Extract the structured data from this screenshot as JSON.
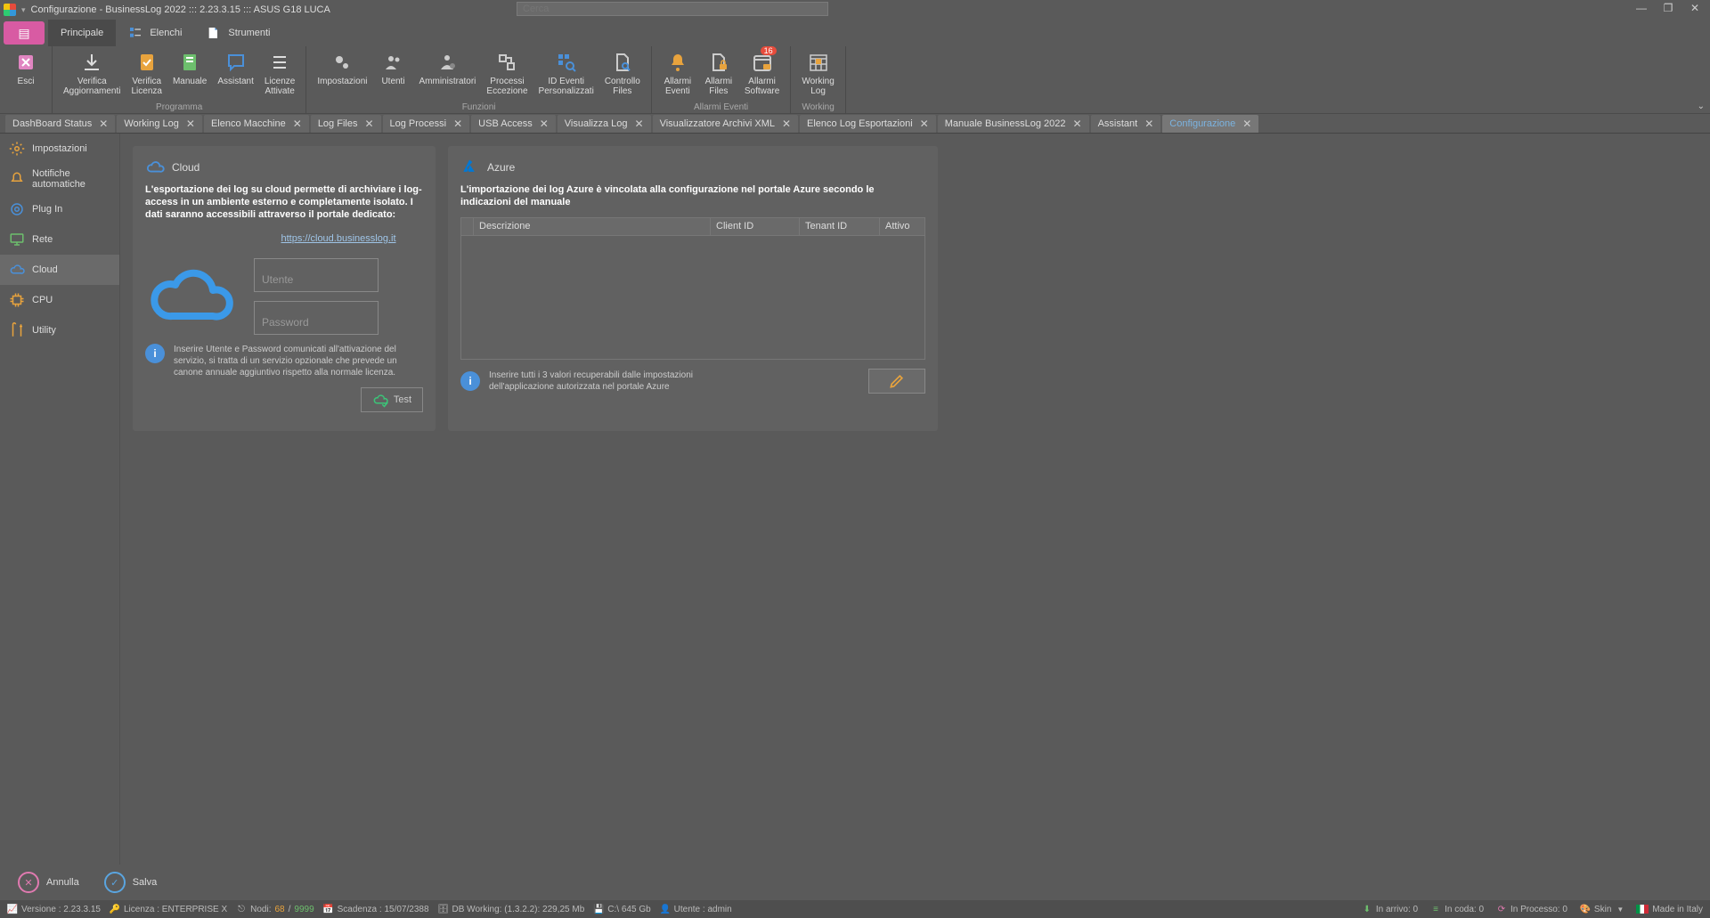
{
  "title": "Configurazione - BusinessLog 2022 ::: 2.23.3.15 ::: ASUS G18 LUCA",
  "search_placeholder": "Cerca",
  "ribbon_tabs": {
    "principale": "Principale",
    "elenchi": "Elenchi",
    "strumenti": "Strumenti"
  },
  "ribbon": {
    "esci": "Esci",
    "verifica_agg": "Verifica\nAggiornamenti",
    "verifica_lic": "Verifica\nLicenza",
    "manuale": "Manuale",
    "assistant": "Assistant",
    "licenze_att": "Licenze\nAttivate",
    "group_prog": "Programma",
    "impostazioni": "Impostazioni",
    "utenti": "Utenti",
    "amministratori": "Amministratori",
    "processi_ecc": "Processi\nEccezione",
    "id_eventi": "ID Eventi\nPersonalizzati",
    "controllo_files": "Controllo\nFiles",
    "group_funz": "Funzioni",
    "allarmi_ev": "Allarmi\nEventi",
    "allarmi_files": "Allarmi\nFiles",
    "allarmi_sw": "Allarmi\nSoftware",
    "group_allarmi": "Allarmi Eventi",
    "working_log": "Working\nLog",
    "group_work": "Working",
    "badge_allarmi_sw": "16"
  },
  "doc_tabs": [
    "DashBoard Status",
    "Working Log",
    "Elenco Macchine",
    "Log Files",
    "Log Processi",
    "USB Access",
    "Visualizza Log",
    "Visualizzatore Archivi XML",
    "Elenco Log Esportazioni",
    "Manuale BusinessLog 2022",
    "Assistant",
    "Configurazione"
  ],
  "sidebar": {
    "impostazioni": "Impostazioni",
    "notifiche": "Notifiche automatiche",
    "plugin": "Plug In",
    "rete": "Rete",
    "cloud": "Cloud",
    "cpu": "CPU",
    "utility": "Utility"
  },
  "cloud_panel": {
    "title": "Cloud",
    "desc": "L'esportazione dei log su cloud permette di archiviare i log-access in un ambiente esterno e completamente isolato. I dati saranno accessibili attraverso il portale dedicato:",
    "link": "https://cloud.businesslog.it",
    "ph_user": "Utente",
    "ph_pwd": "Password",
    "info": "Inserire Utente e Password comunicati all'attivazione del servizio, si tratta di un servizio opzionale che prevede un canone annuale aggiuntivo rispetto alla normale licenza.",
    "test": "Test"
  },
  "azure_panel": {
    "title": "Azure",
    "desc": "L'importazione dei log Azure è vincolata alla configurazione nel portale Azure secondo le indicazioni del manuale",
    "th_desc": "Descrizione",
    "th_cid": "Client ID",
    "th_tid": "Tenant ID",
    "th_att": "Attivo",
    "info": "Inserire tutti i 3 valori recuperabili dalle impostazioni dell'applicazione autorizzata nel portale Azure"
  },
  "bottom": {
    "annulla": "Annulla",
    "salva": "Salva"
  },
  "status": {
    "versione": "Versione : 2.23.3.15",
    "licenza": "Licenza : ENTERPRISE X",
    "nodi_lbl": "Nodi:",
    "nodi_a": "68",
    "nodi_sep": " / ",
    "nodi_b": "9999",
    "scadenza": "Scadenza : 15/07/2388",
    "dbwork": "DB Working: (1.3.2.2): 229,25 Mb",
    "disco": "C:\\ 645 Gb",
    "utente": "Utente : admin",
    "in_arrivo": "In arrivo: 0",
    "in_coda": "In coda: 0",
    "in_proc": "In Processo: 0",
    "skin": "Skin",
    "made": "Made in Italy"
  }
}
